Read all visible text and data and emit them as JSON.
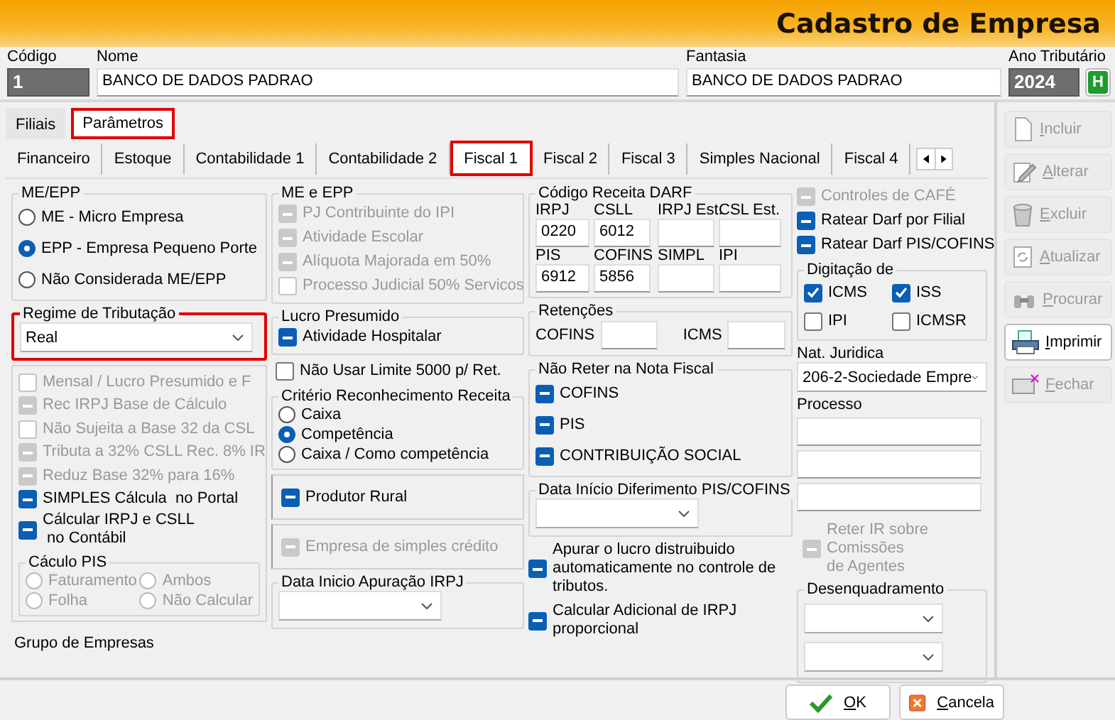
{
  "window": {
    "title": "Cadastro de Empresa"
  },
  "header": {
    "fields": [
      {
        "label": "Código",
        "value": "1",
        "kind": "grey"
      },
      {
        "label": "Nome",
        "value": "BANCO DE DADOS PADRAO",
        "kind": "text"
      },
      {
        "label": "Fantasia",
        "value": "BANCO DE DADOS PADRAO",
        "kind": "text"
      },
      {
        "label": "Ano Tributário",
        "value": "2024",
        "kind": "grey"
      }
    ],
    "help_button": "H"
  },
  "tabs": [
    {
      "label": "Filiais",
      "selected": false,
      "highlighted": false
    },
    {
      "label": "Parâmetros",
      "selected": true,
      "highlighted": true
    }
  ],
  "subtabs": [
    {
      "label": "Financeiro",
      "selected": false,
      "highlighted": false
    },
    {
      "label": "Estoque",
      "selected": false,
      "highlighted": false
    },
    {
      "label": "Contabilidade 1",
      "selected": false,
      "highlighted": false
    },
    {
      "label": "Contabilidade 2",
      "selected": false,
      "highlighted": false
    },
    {
      "label": "Fiscal 1",
      "selected": true,
      "highlighted": true
    },
    {
      "label": "Fiscal 2",
      "selected": false,
      "highlighted": false
    },
    {
      "label": "Fiscal 3",
      "selected": false,
      "highlighted": false
    },
    {
      "label": "Simples Nacional",
      "selected": false,
      "highlighted": false
    },
    {
      "label": "Fiscal 4",
      "selected": false,
      "highlighted": false
    }
  ],
  "me_epp": {
    "title": "ME/EPP",
    "options": [
      {
        "label": "ME - Micro Empresa",
        "selected": false,
        "disabled": false
      },
      {
        "label": "EPP - Empresa Pequeno Porte",
        "selected": true,
        "disabled": false
      },
      {
        "label": "Não Considerada ME/EPP",
        "selected": false,
        "disabled": false
      }
    ]
  },
  "regime": {
    "title": "Regime de Tributação",
    "value": "Real",
    "highlighted": true
  },
  "regime_options": [
    {
      "label": "Mensal / Lucro Presumido e F",
      "checked": false,
      "disabled": true
    },
    {
      "label": "Rec IRPJ Base de Cálculo",
      "checked": true,
      "disabled": true
    },
    {
      "label": "Não Sujeita a Base 32 da CSL",
      "checked": false,
      "disabled": true
    },
    {
      "label": "Tributa a 32% CSLL Rec. 8% IR",
      "checked": true,
      "disabled": true
    },
    {
      "label": "Reduz Base 32% para 16%",
      "checked": true,
      "disabled": true
    },
    {
      "label": "SIMPLES Cálcula  no Portal",
      "checked": true,
      "disabled": false
    },
    {
      "label": "Cálcular IRPJ e CSLL\n no Contábil",
      "checked": true,
      "disabled": false
    }
  ],
  "calculo_pis": {
    "title": "Cáculo PIS",
    "options": [
      {
        "label": "Faturamento",
        "selected": false,
        "disabled": true
      },
      {
        "label": "Ambos",
        "selected": false,
        "disabled": true
      },
      {
        "label": "Folha",
        "selected": false,
        "disabled": true
      },
      {
        "label": "Não Calcular",
        "selected": false,
        "disabled": true
      }
    ]
  },
  "grupo_empresas": {
    "label": "Grupo de Empresas"
  },
  "me_e_epp": {
    "title": "ME e EPP",
    "options": [
      {
        "label": "PJ Contribuinte do IPI",
        "checked": true,
        "disabled": true
      },
      {
        "label": "Atividade Escolar",
        "checked": true,
        "disabled": true
      },
      {
        "label": "Alíquota Majorada em 50%",
        "checked": true,
        "disabled": true
      },
      {
        "label": "Processo Judicial 50% Servicos",
        "checked": false,
        "disabled": true
      }
    ]
  },
  "lucro_presumido": {
    "title": "Lucro Presumido",
    "options": [
      {
        "label": "Atividade Hospitalar",
        "checked": true,
        "disabled": false
      }
    ]
  },
  "nao_usar_limite": {
    "label": "Não Usar Limite 5000 p/ Ret.",
    "checked": false,
    "disabled": false
  },
  "criterio": {
    "title": "Critério Reconhecimento  Receita",
    "options": [
      {
        "label": "Caixa",
        "selected": false,
        "disabled": false
      },
      {
        "label": "Competência",
        "selected": true,
        "disabled": false
      },
      {
        "label": "Caixa / Como competência",
        "selected": false,
        "disabled": false
      }
    ]
  },
  "produtor_rural": {
    "label": "Produtor Rural",
    "checked": true,
    "disabled": false
  },
  "simples_credito": {
    "label": "Empresa de simples crédito",
    "checked": true,
    "disabled": true
  },
  "data_inicio_irpj": {
    "title": "Data Inicio Apuração IRPJ"
  },
  "darf": {
    "title": "Código Receita DARF",
    "fields": [
      {
        "label": "IRPJ",
        "value": "0220"
      },
      {
        "label": "CSLL",
        "value": "6012"
      },
      {
        "label": "IRPJ Est."
      },
      {
        "label": "CSL Est."
      },
      {
        "label": "PIS",
        "value": "6912"
      },
      {
        "label": "COFINS",
        "value": "5856"
      },
      {
        "label": "SIMPL"
      },
      {
        "label": "IPI"
      }
    ]
  },
  "retencoes": {
    "title": "Retenções",
    "fields": [
      {
        "label": "COFINS"
      },
      {
        "label": "ICMS"
      }
    ]
  },
  "nao_reter": {
    "title": "Não Reter na Nota Fiscal",
    "options": [
      {
        "label": "COFINS",
        "checked": true,
        "disabled": false
      },
      {
        "label": "PIS",
        "checked": true,
        "disabled": false
      },
      {
        "label": "CONTRIBUIÇÃO SOCIAL",
        "checked": true,
        "disabled": false
      }
    ]
  },
  "diferimento": {
    "title": "Data Início Diferimento PIS/COFINS"
  },
  "apurar_options": [
    {
      "label": "Apurar o lucro distruibuido automaticamente no controle de tributos.",
      "checked": true,
      "disabled": false
    },
    {
      "label": "Calcular Adicional de IRPJ proporcional",
      "checked": true,
      "disabled": false
    }
  ],
  "darf_options": [
    {
      "label": "Controles de CAFÉ",
      "checked": true,
      "disabled": true
    },
    {
      "label": "Ratear Darf por Filial",
      "checked": true,
      "disabled": false
    },
    {
      "label": "Ratear Darf PIS/COFINS",
      "checked": true,
      "disabled": false
    }
  ],
  "digitacao": {
    "title": "Digitação de",
    "kind": "tick",
    "options": [
      {
        "label": "ICMS",
        "checked": true,
        "disabled": false
      },
      {
        "label": "ISS",
        "checked": true,
        "disabled": false
      },
      {
        "label": "IPI",
        "checked": false,
        "disabled": false
      },
      {
        "label": "ICMSR",
        "checked": false,
        "disabled": false
      }
    ]
  },
  "nat_juridica": {
    "label": "Nat. Juridica",
    "value": "206-2-Sociedade Empre"
  },
  "processo": {
    "label": "Processo"
  },
  "reter_ir": {
    "label": "Reter IR sobre\nComissões\nde Agentes",
    "checked": true,
    "disabled": true
  },
  "desenquadramento": {
    "title": "Desenquadramento"
  },
  "actions": [
    {
      "label": "Incluir",
      "disabled": true
    },
    {
      "label": "Alterar",
      "disabled": true
    },
    {
      "label": "Excluir",
      "disabled": true
    },
    {
      "label": "Atualizar",
      "disabled": true
    },
    {
      "label": "Procurar",
      "disabled": true
    },
    {
      "label": "Imprimir",
      "disabled": false
    },
    {
      "label": "Fechar",
      "disabled": true
    }
  ],
  "footer": {
    "buttons": [
      {
        "label": "OK",
        "kind": "ok"
      },
      {
        "label": "Cancela",
        "kind": "cancel"
      }
    ]
  }
}
